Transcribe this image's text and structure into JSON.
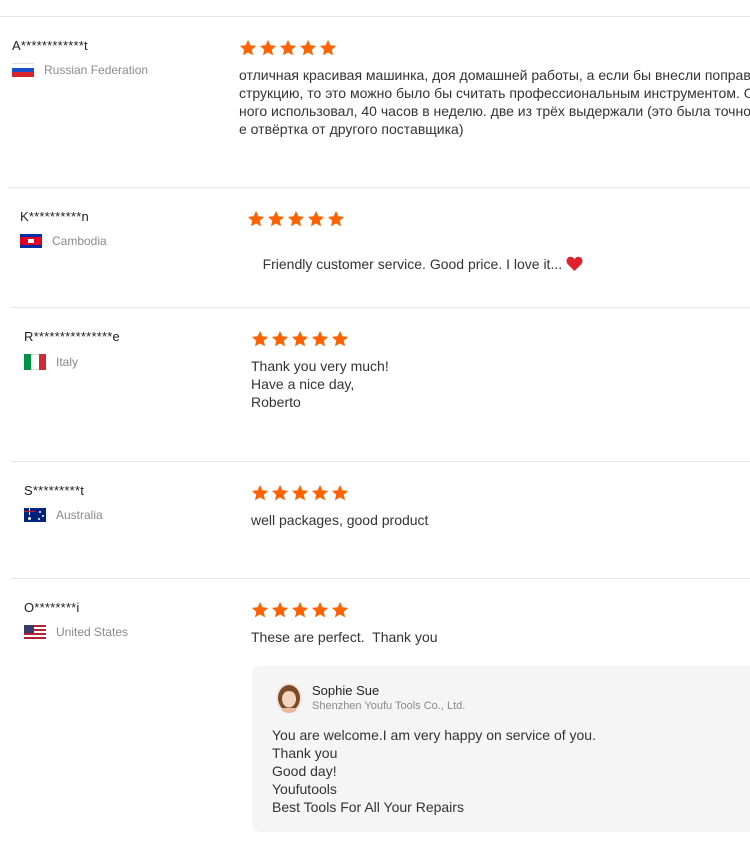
{
  "reviews": [
    {
      "user": "A************t",
      "country": "Russian Federation",
      "flag": "russia-flag",
      "rating": 5,
      "text": "отличная красивая машинка, доя домашней работы, а если бы внесли поправк\nструкцию, то это можно было бы считать профессиональным инструментом. О\nного использовал, 40 часов в неделю. две из трёх выдержали (это была точно т\nе отвёртка от другого поставщика)"
    },
    {
      "user": "K**********n",
      "country": "Cambodia",
      "flag": "cambodia-flag",
      "rating": 5,
      "text": "Friendly customer service. Good price. I love it..."
    },
    {
      "user": "R***************e",
      "country": "Italy",
      "flag": "italy-flag",
      "rating": 5,
      "text": "Thank you very much!\nHave a nice day,\nRoberto"
    },
    {
      "user": "S*********t",
      "country": "Australia",
      "flag": "australia-flag",
      "rating": 5,
      "text": "well packages, good product"
    },
    {
      "user": "O********i",
      "country": "United States",
      "flag": "usa-flag",
      "rating": 5,
      "text": "These are perfect.  Thank you",
      "reply": {
        "name": "Sophie Sue",
        "company": "Shenzhen Youfu Tools Co., Ltd.",
        "text": "You are welcome.I am very happy on service of you.\nThank you\nGood day!\nYoufutools\nBest Tools For All Your Repairs"
      }
    }
  ],
  "colors": {
    "star": "#ff6200",
    "heart": "#e0202a"
  }
}
